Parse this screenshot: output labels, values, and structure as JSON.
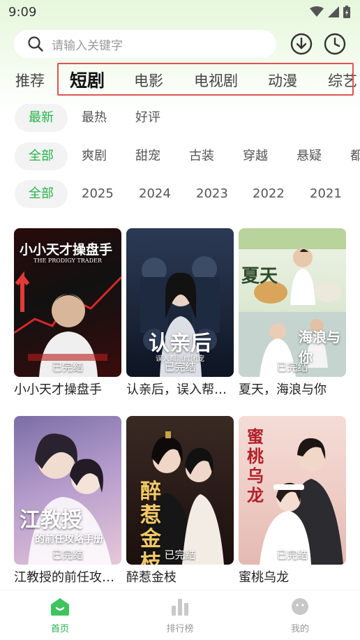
{
  "status": {
    "time": "9:09"
  },
  "search": {
    "placeholder": "请输入关键字"
  },
  "tabs": [
    "推荐",
    "短剧",
    "电影",
    "电视剧",
    "动漫",
    "综艺"
  ],
  "active_tab": "短剧",
  "sort_filters": [
    "最新",
    "最热",
    "好评"
  ],
  "genre_filters": [
    "全部",
    "爽剧",
    "甜宠",
    "古装",
    "穿越",
    "悬疑",
    "都"
  ],
  "year_filters": [
    "全部",
    "2025",
    "2024",
    "2023",
    "2022",
    "2021"
  ],
  "cards": [
    {
      "title": "小小天才操盘手",
      "badge": "已完结",
      "poster_text": "小小天才操盘手",
      "poster_sub": "THE PRODIGY TRADER"
    },
    {
      "title": "认亲后，误入帮…",
      "badge": "已完结",
      "poster_text": "认亲后",
      "poster_sub": "误入帮派成团宠"
    },
    {
      "title": "夏天，海浪与你",
      "badge": "已完结",
      "poster_text": "夏天",
      "poster_sub": "海浪与你"
    },
    {
      "title": "江教授的前任攻…",
      "badge": "已完结",
      "poster_text": "江教授",
      "poster_sub": "的前任攻略手册"
    },
    {
      "title": "醉惹金枝",
      "badge": "已完结",
      "poster_text": "醉惹金枝",
      "poster_sub": ""
    },
    {
      "title": "蜜桃乌龙",
      "badge": "已完结",
      "poster_text": "蜜桃乌龙",
      "poster_sub": ""
    }
  ],
  "nav": {
    "home": "首页",
    "rank": "排行榜",
    "mine": "我的"
  },
  "colors": {
    "accent": "#25b34a",
    "highlight_box": "#e05353"
  }
}
